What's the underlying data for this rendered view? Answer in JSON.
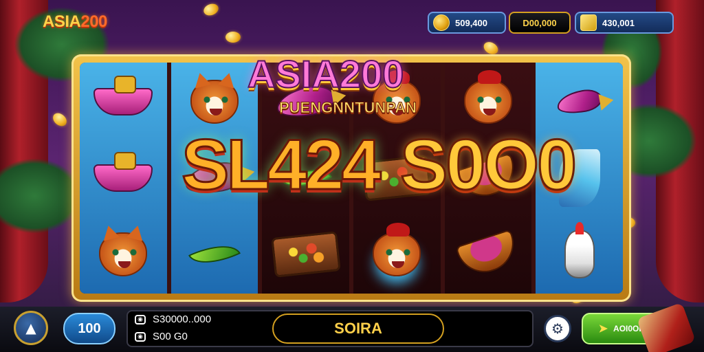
{
  "logo": {
    "part1": "ASIA",
    "part2": "200"
  },
  "balances": {
    "coins": "509,400",
    "middle": "D00,000",
    "gold": "430,001"
  },
  "titles": {
    "main": "ASIA200",
    "sub": "PUENGNNTUNPAN",
    "big_left": "SL424",
    "big_right": "S0O0"
  },
  "reels": [
    {
      "style": "blue",
      "symbols": [
        "boat-icon",
        "boat-icon",
        "fox-icon"
      ]
    },
    {
      "style": "blue",
      "symbols": [
        "fox-icon",
        "fish-icon",
        "leaf-icon"
      ]
    },
    {
      "style": "dark",
      "symbols": [
        "fish-icon",
        "leaf-icon",
        "tray-icon"
      ]
    },
    {
      "style": "dark",
      "symbols": [
        "fox-icon",
        "tray-icon",
        "fox-icon"
      ]
    },
    {
      "style": "dark",
      "symbols": [
        "fox-icon",
        "bowl-icon",
        "bowl-icon"
      ]
    },
    {
      "style": "blue",
      "symbols": [
        "fish-icon",
        "wisp-icon",
        "lamp-icon"
      ]
    }
  ],
  "controls": {
    "bet_value": "100",
    "line1_value": "S30000..000",
    "line2_value": "S00 G0",
    "spin_label": "SOIRA",
    "auto_label": "AOI0OIII"
  },
  "icons": {
    "home": "wolf-head-icon",
    "settings": "gear-icon",
    "auto": "pointer-icon"
  },
  "colors": {
    "accent_gold": "#ffd34a",
    "frame_gold": "#f3c34a",
    "reel_blue": "#4ab3e8",
    "auto_green": "#7ad83a",
    "bet_blue": "#2a8ad8"
  }
}
